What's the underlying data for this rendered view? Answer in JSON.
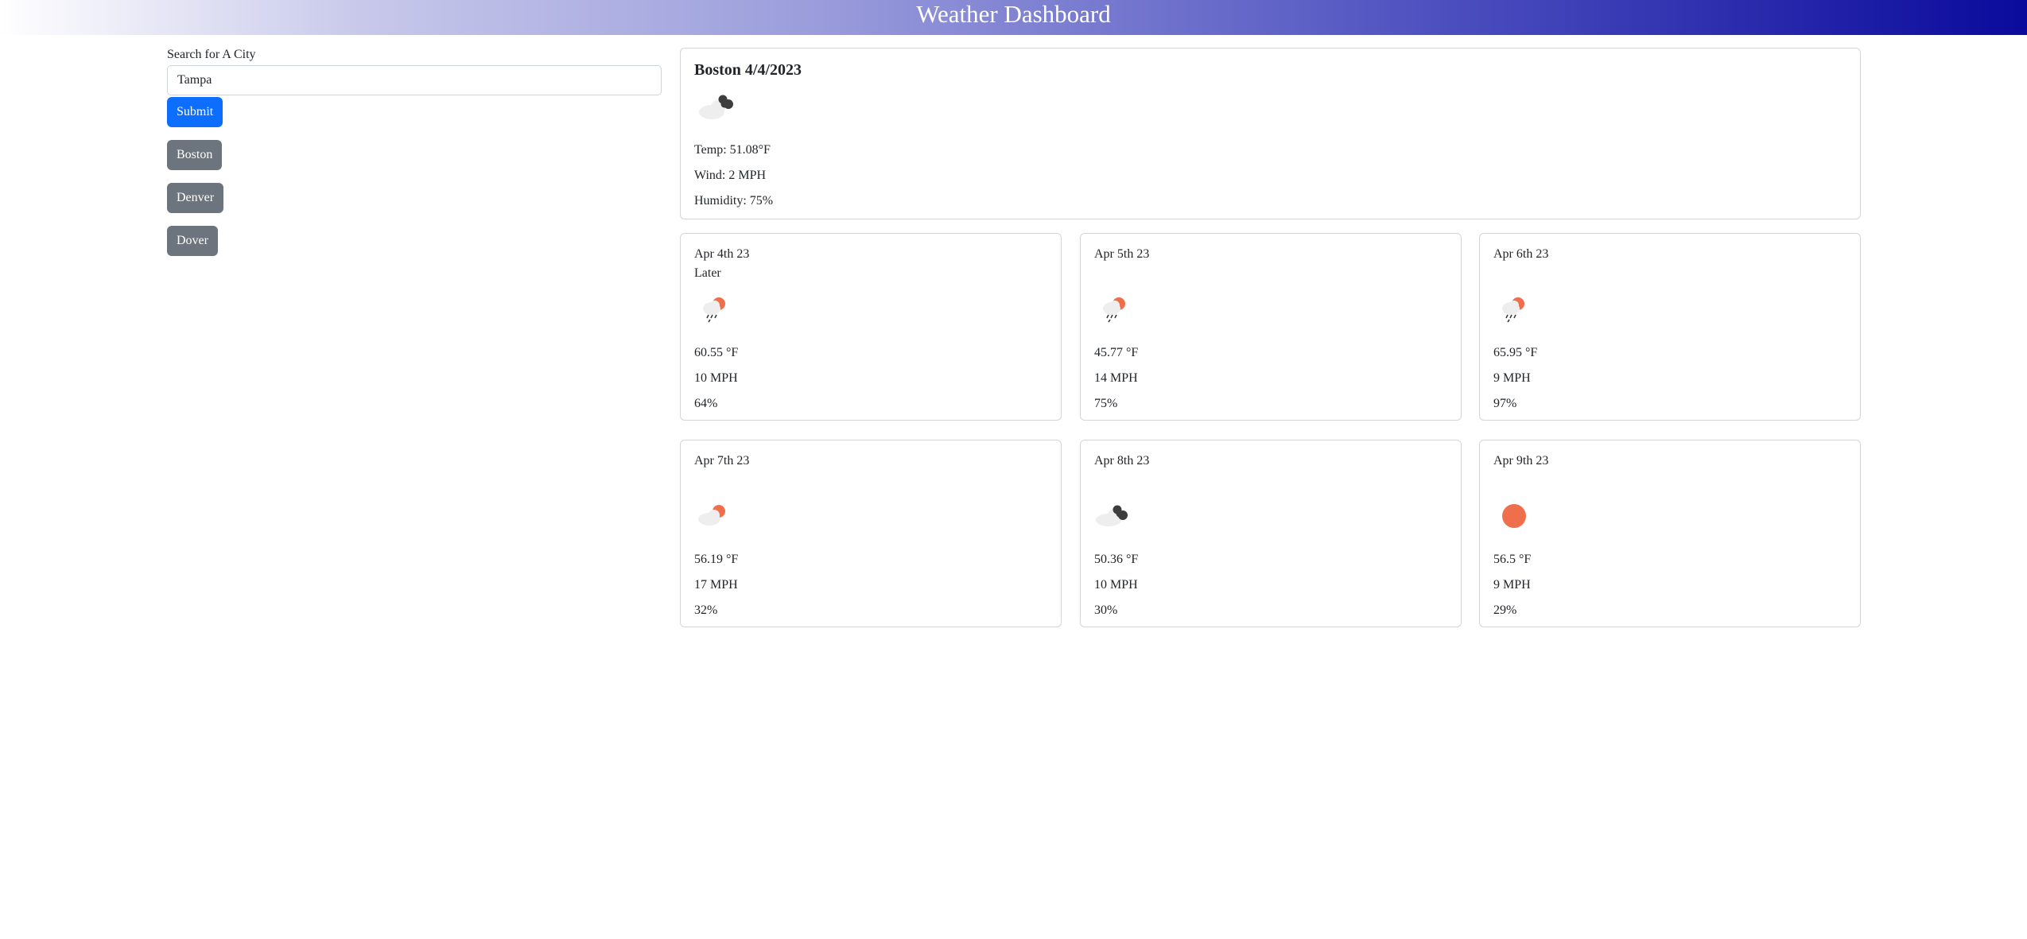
{
  "header": {
    "title": "Weather Dashboard"
  },
  "sidebar": {
    "search_label": "Search for A City",
    "search_value": "Tampa",
    "submit_label": "Submit",
    "history": [
      "Boston",
      "Denver",
      "Dover"
    ]
  },
  "current": {
    "title": "Boston 4/4/2023",
    "icon": "cloudy-icon",
    "temp": "Temp: 51.08°F",
    "wind": "Wind: 2 MPH",
    "humidity": "Humidity: 75%"
  },
  "forecast": [
    {
      "date": "Apr 4th 23",
      "label": "Later",
      "icon": "rain-sun-icon",
      "temp": "60.55 °F",
      "wind": "10 MPH",
      "humidity": "64%"
    },
    {
      "date": "Apr 5th 23",
      "label": "",
      "icon": "rain-sun-icon",
      "temp": "45.77 °F",
      "wind": "14 MPH",
      "humidity": "75%"
    },
    {
      "date": "Apr 6th 23",
      "label": "",
      "icon": "rain-sun-icon",
      "temp": "65.95 °F",
      "wind": "9 MPH",
      "humidity": "97%"
    },
    {
      "date": "Apr 7th 23",
      "label": "",
      "icon": "partly-cloudy-icon",
      "temp": "56.19 °F",
      "wind": "17 MPH",
      "humidity": "32%"
    },
    {
      "date": "Apr 8th 23",
      "label": "",
      "icon": "cloudy-icon",
      "temp": "50.36 °F",
      "wind": "10 MPH",
      "humidity": "30%"
    },
    {
      "date": "Apr 9th 23",
      "label": "",
      "icon": "sun-icon",
      "temp": "56.5 °F",
      "wind": "9 MPH",
      "humidity": "29%"
    }
  ],
  "colors": {
    "primary_button": "#0d6efd",
    "history_button": "#6c757d",
    "sun": "#ef6f4c",
    "dark_cloud": "#3d3d3d",
    "light_cloud": "#eeeeee"
  }
}
